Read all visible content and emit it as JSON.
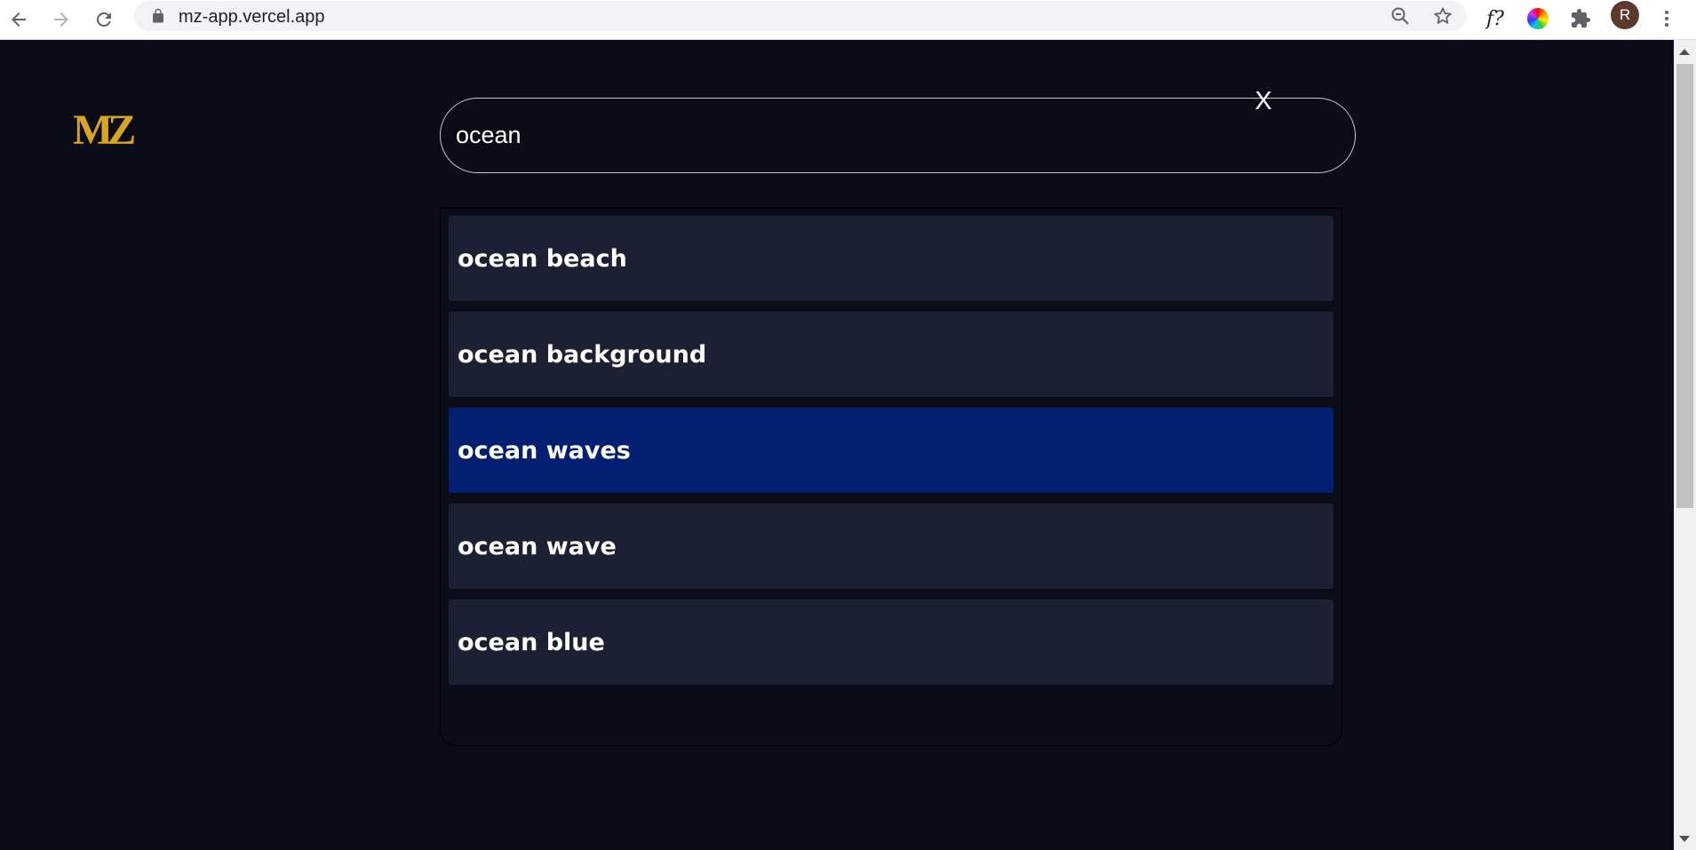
{
  "browser": {
    "url": "mz-app.vercel.app",
    "extension_fx_label": "f?",
    "profile_initial": "R"
  },
  "app": {
    "logo_text": "MZ",
    "search": {
      "value": "ocean",
      "clear_label": "X"
    },
    "suggestions": [
      {
        "label": "ocean beach",
        "active": false
      },
      {
        "label": "ocean background",
        "active": false
      },
      {
        "label": "ocean waves",
        "active": true
      },
      {
        "label": "ocean wave",
        "active": false
      },
      {
        "label": "ocean blue",
        "active": false
      }
    ]
  },
  "colors": {
    "page_background": "#0a0d17",
    "suggestion_background": "#1b2032",
    "suggestion_active_background": "#021f72",
    "logo_gold": "#d8a51c",
    "search_border": "#c5c8d0"
  },
  "icons": {
    "back": "back-arrow-icon",
    "forward": "forward-arrow-icon",
    "reload": "reload-icon",
    "lock": "lock-icon",
    "zoom": "zoom-out-icon",
    "bookmark": "star-icon",
    "color_ext": "color-wheel-icon",
    "extensions": "puzzle-icon",
    "menu": "kebab-menu-icon"
  }
}
